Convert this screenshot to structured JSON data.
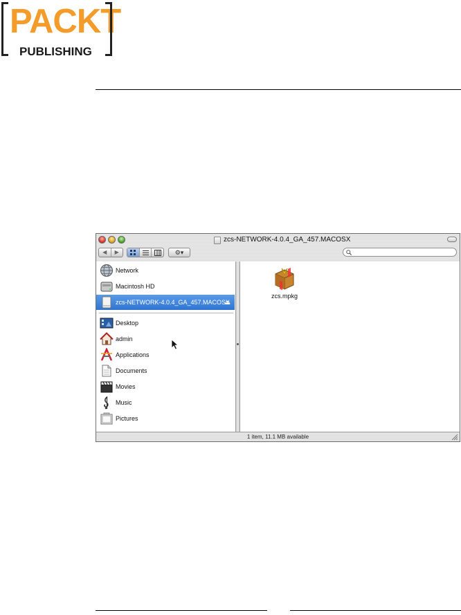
{
  "logo": {
    "word": "PACKT",
    "sub": "PUBLISHING"
  },
  "window": {
    "title": "zcs-NETWORK-4.0.4_GA_457.MACOSX",
    "nav_back": "◀",
    "nav_forward": "▶",
    "action_menu": "⚙▾",
    "search": {
      "value": "",
      "placeholder": ""
    }
  },
  "sidebar": {
    "items": [
      {
        "label": "Network",
        "icon": "network-globe-icon"
      },
      {
        "label": "Macintosh HD",
        "icon": "hard-drive-icon"
      },
      {
        "label": "zcs-NETWORK-4.0.4_GA_457.MACOSX",
        "icon": "disk-image-icon",
        "selected": true,
        "eject": "⏏"
      },
      {
        "label": "Desktop",
        "icon": "desktop-icon"
      },
      {
        "label": "admin",
        "icon": "home-icon"
      },
      {
        "label": "Applications",
        "icon": "applications-icon"
      },
      {
        "label": "Documents",
        "icon": "documents-icon"
      },
      {
        "label": "Movies",
        "icon": "movies-icon"
      },
      {
        "label": "Music",
        "icon": "music-icon"
      },
      {
        "label": "Pictures",
        "icon": "pictures-icon"
      }
    ]
  },
  "content": {
    "files": [
      {
        "name": "zcs.mpkg",
        "icon": "package-icon"
      }
    ]
  },
  "status": {
    "text": "1 item, 11.1 MB available"
  },
  "colors": {
    "selection": "#3a80d8",
    "logo_orange": "#f39c2a"
  }
}
